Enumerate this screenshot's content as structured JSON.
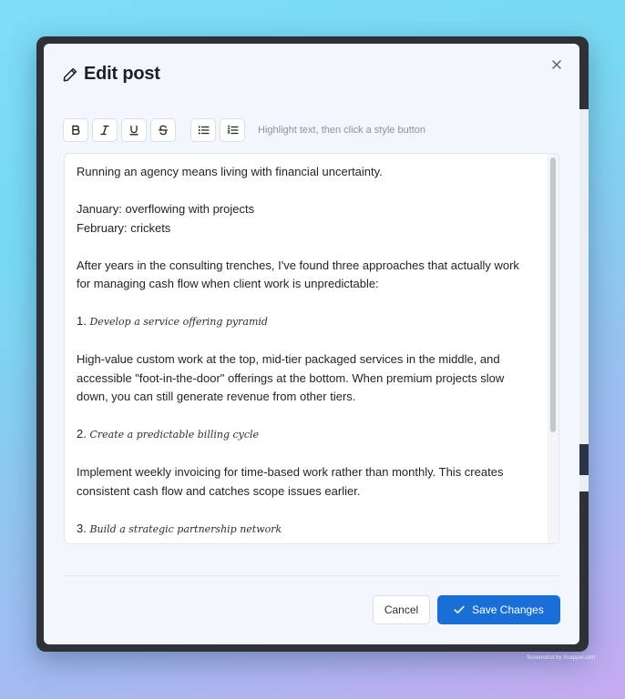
{
  "modal": {
    "title": "Edit post",
    "close_label": "×"
  },
  "toolbar": {
    "buttons": [
      {
        "name": "bold",
        "icon": "bold-icon",
        "glyph": "B"
      },
      {
        "name": "italic",
        "icon": "italic-icon",
        "glyph": "I"
      },
      {
        "name": "underline",
        "icon": "underline-icon",
        "glyph": "U"
      },
      {
        "name": "strikethrough",
        "icon": "strikethrough-icon",
        "glyph": "S"
      },
      {
        "name": "bullet-list",
        "icon": "bullet-list-icon"
      },
      {
        "name": "numbered-list",
        "icon": "numbered-list-icon"
      }
    ],
    "hint": "Highlight text, then click a style button"
  },
  "editor": {
    "paragraphs": {
      "p1": "Running an agency means living with financial uncertainty.",
      "p2_line1": "January: overflowing with projects",
      "p2_line2": "February: crickets",
      "p3": "After years in the consulting trenches, I've found three approaches that actually work for managing cash flow when client work is unpredictable:",
      "item1_num": "1.",
      "item1_text": "Develop a service offering pyramid",
      "p4": "High-value custom work at the top, mid-tier packaged services in the middle, and accessible \"foot-in-the-door\" offerings at the bottom. When premium projects slow down, you can still generate revenue from other tiers.",
      "item2_num": "2.",
      "item2_text": "Create a predictable billing cycle",
      "p5": "Implement weekly invoicing for time-based work rather than monthly. This creates consistent cash flow and catches scope issues earlier.",
      "item3_num": "3.",
      "item3_text": "Build a strategic partnership network"
    }
  },
  "footer": {
    "cancel_label": "Cancel",
    "save_label": "Save Changes"
  },
  "watermark": "Screenshot by Xnapper.com",
  "colors": {
    "primary": "#1a6fd6",
    "modal_bg": "#f3f6fc",
    "text": "#20242c",
    "hint": "#8a93a1"
  }
}
